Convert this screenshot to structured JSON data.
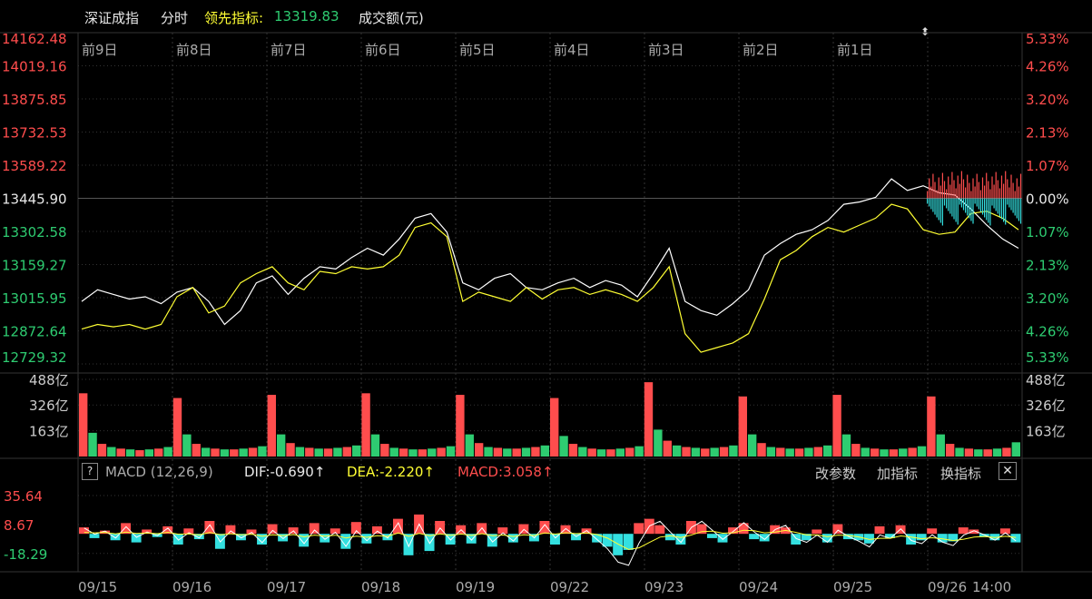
{
  "header": {
    "index_name": "深证成指",
    "mode": "分时",
    "leader_label": "领先指标:",
    "leader_value": "13319.83",
    "volume_label": "成交额(元)",
    "sort_icon": "sort-arrows-icon"
  },
  "colors": {
    "up": "#ff4d4d",
    "down": "#2ecc71",
    "flat": "#e8e8e8",
    "price_line": "#ffffff",
    "leader_line": "#ffff33",
    "macd_neg": "#33e0e0",
    "grid": "#333333"
  },
  "macd_panel": {
    "help_label": "?",
    "name": "MACD (12,26,9)",
    "dif": "DIF:-0.690↑",
    "dea": "DEA:-2.220↑",
    "macd": "MACD:3.058↑",
    "btn_params": "改参数",
    "btn_add": "加指标",
    "btn_switch": "换指标",
    "close_label": "✕"
  },
  "chart_data": [
    {
      "type": "line",
      "name": "price",
      "days": [
        "前9日",
        "前8日",
        "前7日",
        "前6日",
        "前5日",
        "前4日",
        "前3日",
        "前2日",
        "前1日",
        ""
      ],
      "ylim": [
        12729.32,
        14162.48
      ],
      "base": 13445.9,
      "y_ticks": [
        "14162.48",
        "14019.16",
        "13875.85",
        "13732.53",
        "13589.22",
        "13445.90",
        "13302.58",
        "13159.27",
        "13015.95",
        "12872.64",
        "12729.32"
      ],
      "pct_ticks": [
        "5.33%",
        "4.26%",
        "3.20%",
        "2.13%",
        "1.07%",
        "0.00%",
        "1.07%",
        "2.13%",
        "3.20%",
        "4.26%",
        "5.33%"
      ],
      "series": [
        {
          "name": "白线",
          "values": [
            13000,
            13050,
            13030,
            13010,
            13020,
            12990,
            13040,
            13060,
            13000,
            12900,
            12960,
            13080,
            13110,
            13030,
            13100,
            13150,
            13140,
            13190,
            13230,
            13200,
            13270,
            13360,
            13380,
            13300,
            13080,
            13050,
            13100,
            13120,
            13060,
            13050,
            13080,
            13100,
            13060,
            13090,
            13070,
            13020,
            13120,
            13230,
            13000,
            12960,
            12940,
            12990,
            13050,
            13200,
            13250,
            13290,
            13310,
            13350,
            13420,
            13430,
            13450,
            13530,
            13480,
            13500,
            13470,
            13460,
            13400,
            13330,
            13270,
            13230
          ]
        },
        {
          "name": "黄线",
          "values": [
            12880,
            12900,
            12890,
            12900,
            12880,
            12900,
            13020,
            13060,
            12950,
            12980,
            13080,
            13120,
            13150,
            13080,
            13050,
            13130,
            13120,
            13150,
            13140,
            13150,
            13200,
            13320,
            13340,
            13280,
            13000,
            13040,
            13020,
            13000,
            13060,
            13010,
            13050,
            13060,
            13030,
            13050,
            13030,
            13000,
            13060,
            13150,
            12860,
            12780,
            12800,
            12820,
            12860,
            13010,
            13180,
            13220,
            13280,
            13320,
            13300,
            13330,
            13360,
            13420,
            13400,
            13310,
            13290,
            13300,
            13380,
            13390,
            13360,
            13310
          ]
        }
      ]
    },
    {
      "type": "bar",
      "name": "volume",
      "y_ticks": [
        "488亿",
        "326亿",
        "163亿"
      ],
      "ylim": [
        0,
        488
      ],
      "values": [
        400,
        150,
        80,
        60,
        50,
        45,
        40,
        45,
        50,
        60,
        370,
        140,
        80,
        55,
        50,
        45,
        45,
        50,
        55,
        65,
        390,
        140,
        85,
        60,
        55,
        50,
        50,
        55,
        60,
        70,
        400,
        140,
        80,
        55,
        50,
        45,
        45,
        50,
        55,
        65,
        390,
        140,
        85,
        60,
        55,
        50,
        50,
        55,
        60,
        70,
        370,
        130,
        80,
        60,
        50,
        45,
        45,
        50,
        55,
        65,
        470,
        170,
        100,
        70,
        60,
        55,
        50,
        55,
        60,
        70,
        380,
        140,
        85,
        60,
        55,
        50,
        50,
        55,
        60,
        70,
        390,
        140,
        80,
        55,
        50,
        45,
        45,
        50,
        55,
        65,
        380,
        140,
        80,
        55,
        50,
        45,
        45,
        50,
        55,
        90
      ]
    },
    {
      "type": "bar",
      "name": "macd",
      "y_ticks": [
        "35.64",
        "8.67",
        "-18.29"
      ],
      "ylim": [
        -32,
        45
      ],
      "values": [
        6,
        -4,
        3,
        -6,
        10,
        -8,
        4,
        -3,
        7,
        -10,
        5,
        -5,
        12,
        -14,
        8,
        -6,
        4,
        -10,
        9,
        -7,
        6,
        -12,
        10,
        -8,
        5,
        -14,
        11,
        -9,
        7,
        -6,
        14,
        -20,
        18,
        -16,
        12,
        -10,
        8,
        -9,
        10,
        -12,
        6,
        -8,
        9,
        -7,
        12,
        -10,
        8,
        -6,
        5,
        -8,
        -12,
        -20,
        -15,
        10,
        14,
        8,
        -6,
        -10,
        12,
        9,
        -4,
        -8,
        6,
        10,
        -5,
        -7,
        8,
        6,
        -10,
        -6,
        4,
        -8,
        9,
        -5,
        -6,
        -9,
        7,
        -4,
        8,
        -10,
        -6,
        5,
        -8,
        -7,
        6,
        4,
        -3,
        -6,
        5,
        -8
      ]
    }
  ],
  "x_dates": [
    "09/15",
    "09/16",
    "09/17",
    "09/18",
    "09/19",
    "09/22",
    "09/23",
    "09/24",
    "09/25",
    "09/26",
    "14:00"
  ]
}
